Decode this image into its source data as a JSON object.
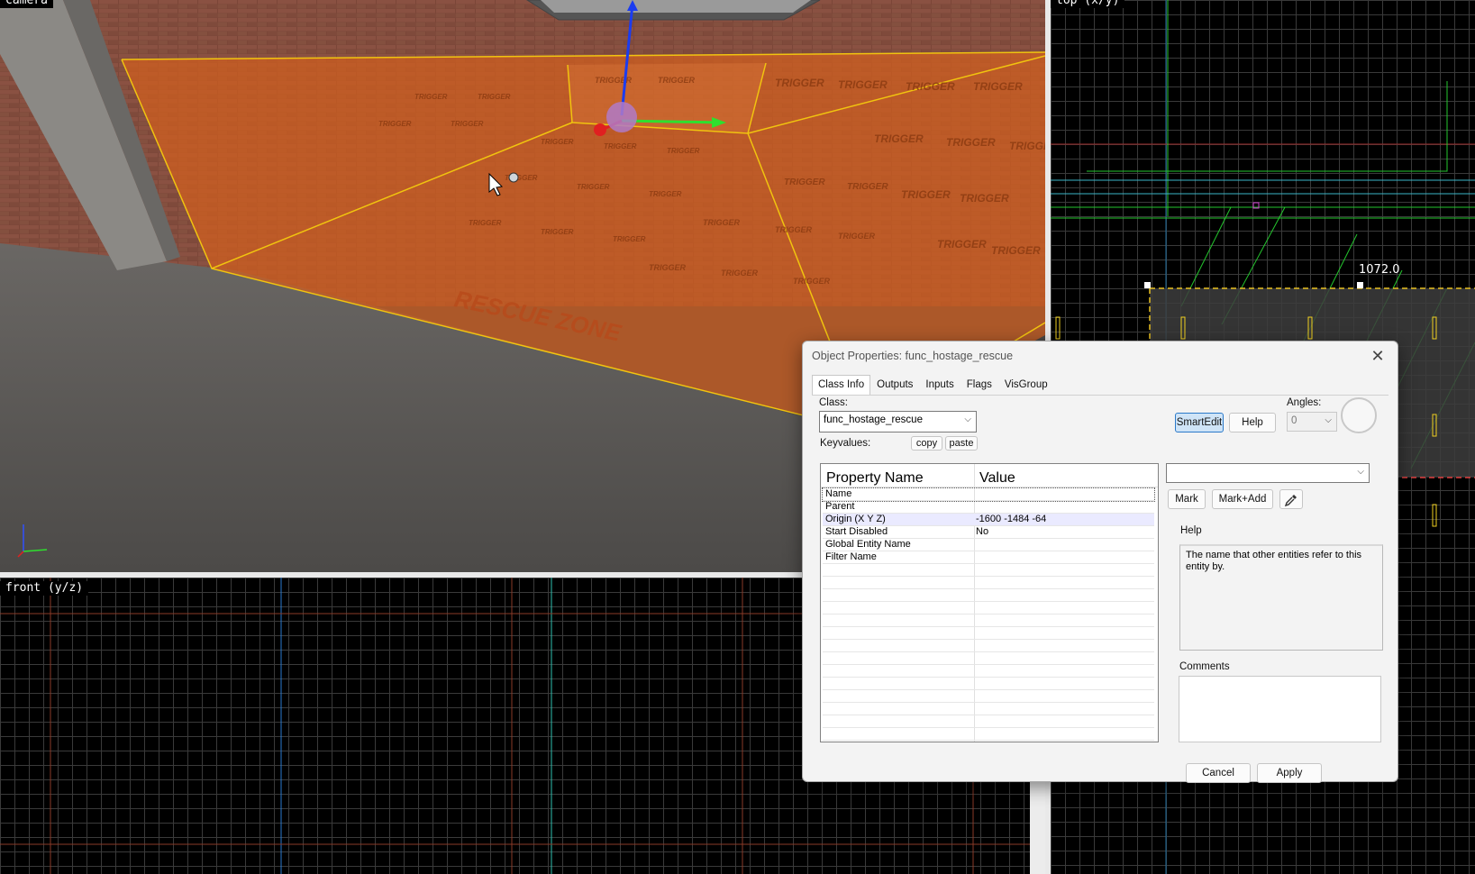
{
  "viewports": {
    "camera": {
      "label": "camera"
    },
    "top": {
      "label": "top (x/y)",
      "dimension": "1072.0"
    },
    "front": {
      "label": "front (y/z)"
    }
  },
  "scene": {
    "trigger_text": "TRIGGER",
    "zone_text": "RESCUE ZONE",
    "colors": {
      "trigger": "#d2601e",
      "outline": "#f1c40f",
      "wall": "#7a4034",
      "floor": "#5a5856"
    }
  },
  "dialog": {
    "title": "Object Properties: func_hostage_rescue",
    "close_icon": "close-icon",
    "tabs": [
      "Class Info",
      "Outputs",
      "Inputs",
      "Flags",
      "VisGroup"
    ],
    "active_tab": "Class Info",
    "class_label": "Class:",
    "class_value": "func_hostage_rescue",
    "keyvalues_label": "Keyvalues:",
    "copy_label": "copy",
    "paste_label": "paste",
    "smartedit_label": "SmartEdit",
    "help_button_label": "Help",
    "angles_label": "Angles:",
    "angles_value": "0",
    "table": {
      "col1": "Property Name",
      "col2": "Value",
      "rows": [
        {
          "name": "Name",
          "value": ""
        },
        {
          "name": "Parent",
          "value": ""
        },
        {
          "name": "Origin (X Y Z)",
          "value": "-1600 -1484 -64"
        },
        {
          "name": "Start Disabled",
          "value": "No"
        },
        {
          "name": "Global Entity Name",
          "value": ""
        },
        {
          "name": "Filter Name",
          "value": ""
        }
      ],
      "empty_rows": 14
    },
    "value_combo": "",
    "mark_label": "Mark",
    "markadd_label": "Mark+Add",
    "eyedropper_icon": "eyedropper-icon",
    "help_label": "Help",
    "help_text": "The name that other entities refer to this entity by.",
    "comments_label": "Comments",
    "cancel_label": "Cancel",
    "apply_label": "Apply",
    "accent_color": "#2c7ac9"
  }
}
